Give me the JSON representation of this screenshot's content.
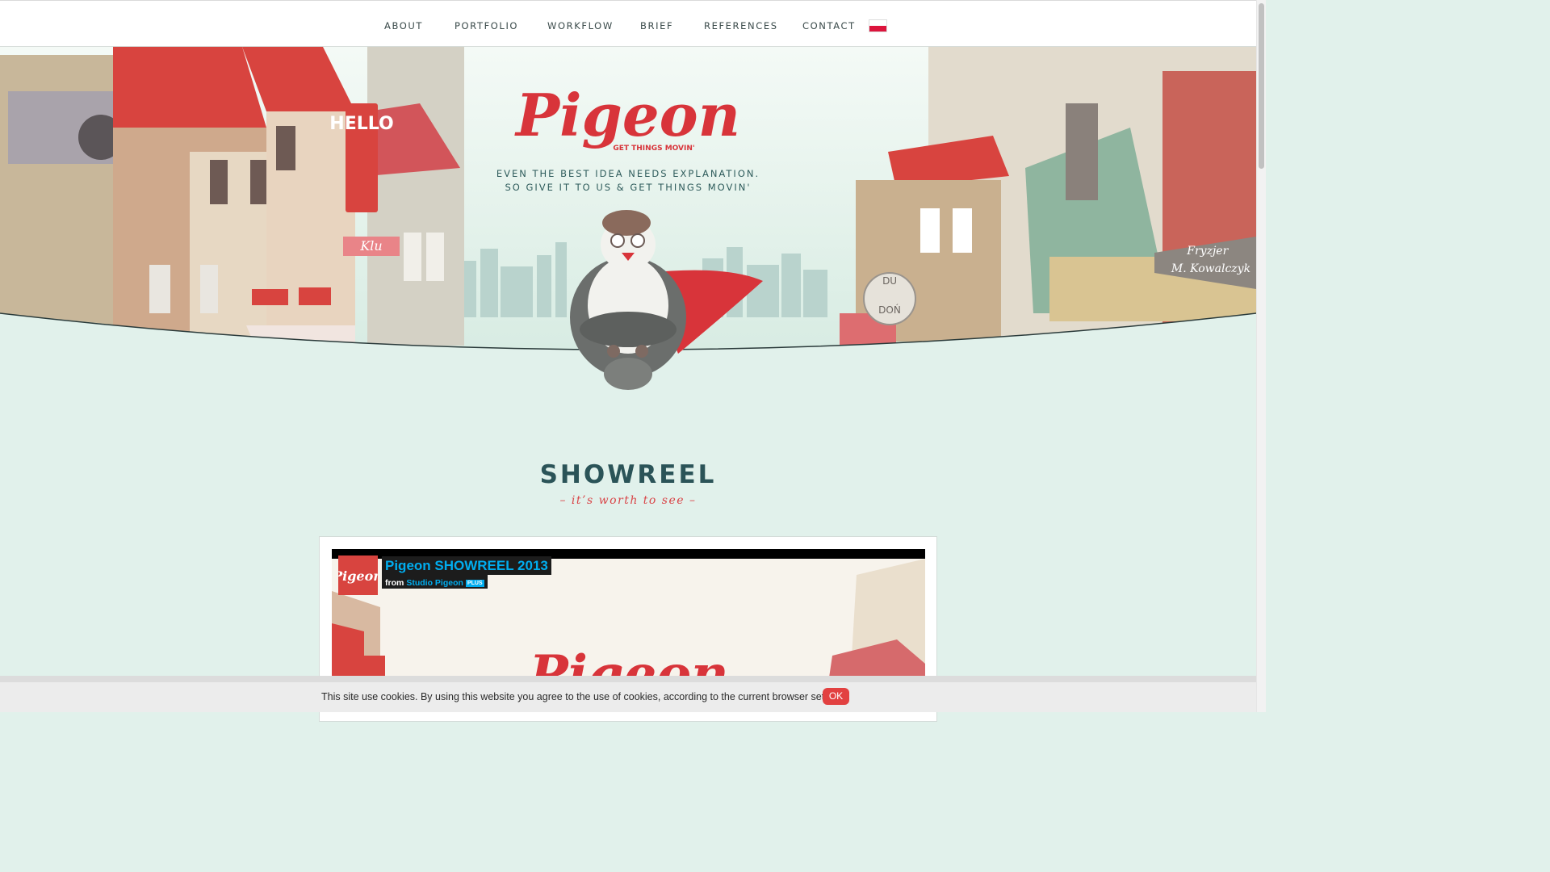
{
  "nav": {
    "items": [
      {
        "label": "ABOUT"
      },
      {
        "label": "PORTFOLIO"
      },
      {
        "label": "WORKFLOW"
      },
      {
        "label": "BRIEF"
      },
      {
        "label": "REFERENCES"
      },
      {
        "label": "CONTACT"
      }
    ],
    "language_flag": "poland-flag-icon"
  },
  "hero": {
    "logo_text": "Pigeon",
    "logo_tagline": "GET THINGS MOVIN'",
    "tagline_line1": "EVEN THE BEST IDEA NEEDS EXPLANATION.",
    "tagline_line2": "SO GIVE IT TO US & GET THINGS MOVIN'",
    "sign_hello": "HELLO",
    "sign_klu": "Klu",
    "sign_du_don": [
      "DU",
      "DOŃ"
    ],
    "sign_fryzjer": [
      "Fryzjer",
      "M. Kowalczyk"
    ]
  },
  "showreel": {
    "title": "SHOWREEL",
    "subtitle": "– it’s worth to see –",
    "video": {
      "title": "Pigeon SHOWREEL 2013",
      "from_label": "from",
      "author": "Studio Pigeon",
      "badge": "PLUS",
      "thumb_logo": "Pigeon",
      "preview_logo": "Pigeon"
    }
  },
  "cookie": {
    "message": "This site use cookies. By using this website you agree to the use of cookies, according to the current browser settings.",
    "ok_label": "OK"
  },
  "colors": {
    "accent_red": "#d8343a",
    "teal_text": "#2b5458",
    "background": "#e1f1eb"
  }
}
